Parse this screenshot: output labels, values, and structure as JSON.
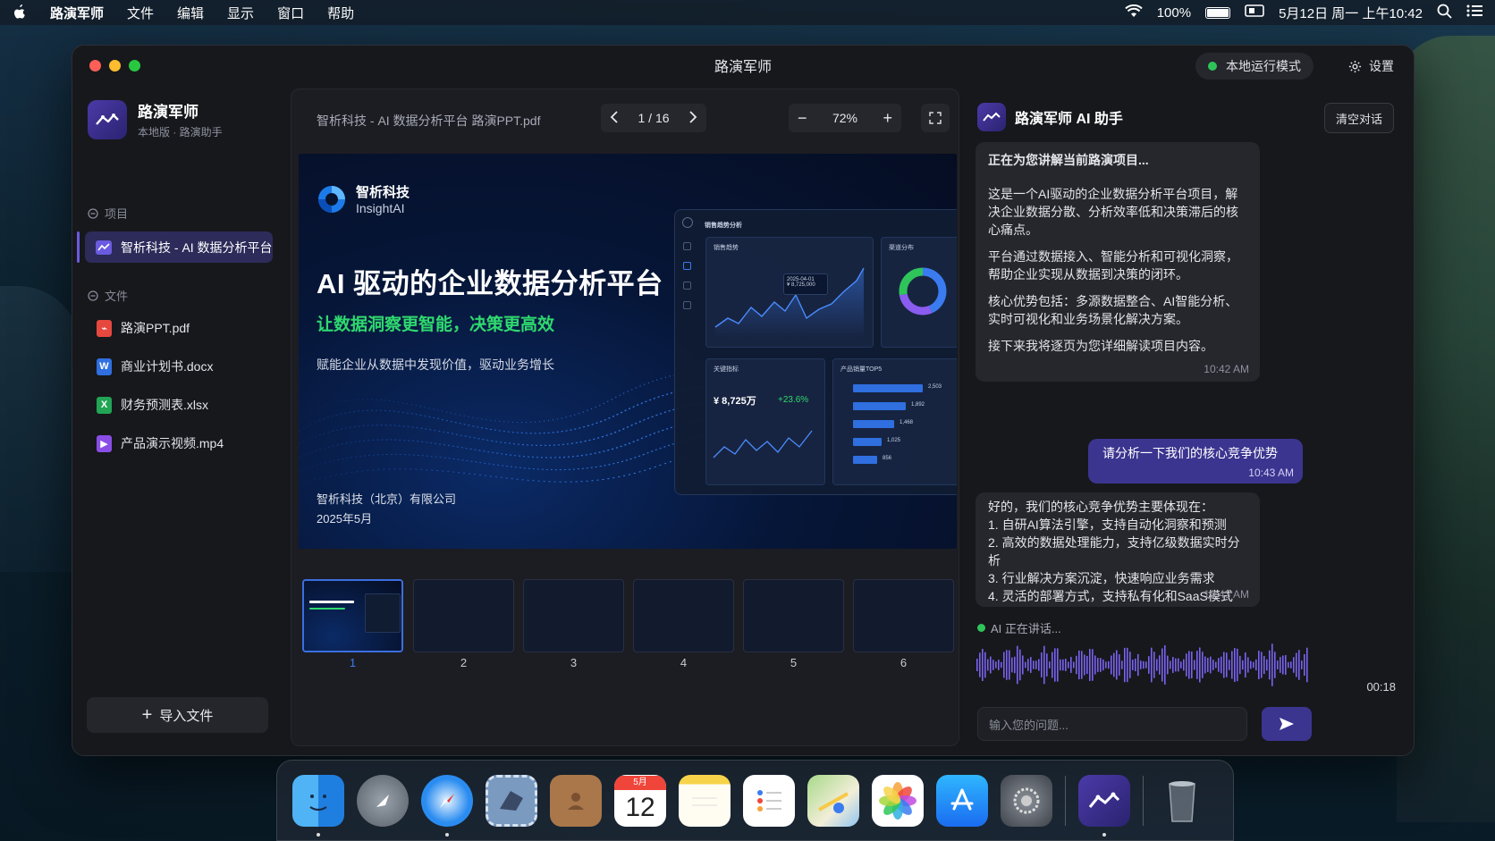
{
  "menubar": {
    "app": "路演军师",
    "menus": [
      "文件",
      "编辑",
      "显示",
      "窗口",
      "帮助"
    ],
    "battery": "100%",
    "datetime": "5月12日 周一 上午10:42",
    "battery_level": 1.0
  },
  "window": {
    "title": "路演军师",
    "mode": "本地运行模式",
    "settings": "设置"
  },
  "sidebar": {
    "app_name": "路演军师",
    "app_sub": "本地版 · 路演助手",
    "projects_label": "项目",
    "project": "智析科技 - AI 数据分析平台",
    "files_label": "文件",
    "files": [
      {
        "name": "路演PPT.pdf",
        "icon": "pdf-icon",
        "color": "#e5483e"
      },
      {
        "name": "商业计划书.docx",
        "icon": "word-icon",
        "color": "#2f6fe0"
      },
      {
        "name": "财务预测表.xlsx",
        "icon": "excel-icon",
        "color": "#22a455"
      },
      {
        "name": "产品演示视频.mp4",
        "icon": "video-icon",
        "color": "#8a4ee6"
      }
    ],
    "import": "导入文件"
  },
  "viewer": {
    "filename": "智析科技 - AI 数据分析平台 路演PPT.pdf",
    "page": "1 / 16",
    "zoom": "72%"
  },
  "slide": {
    "brand_cn": "智析科技",
    "brand_en": "InsightAI",
    "title": "AI 驱动的企业数据分析平台",
    "subtitle": "让数据洞察更智能，决策更高效",
    "desc": "赋能企业从数据中发现价值，驱动业务增长",
    "company": "智析科技（北京）有限公司",
    "date": "2025年5月",
    "dashboard": {
      "header": "销售趋势分析",
      "c1": "销售趋势",
      "c2": "渠道分布",
      "c3": "关键指标",
      "c4": "产品销量TOP5",
      "tooltip_date": "2025-04-01",
      "tooltip_val": "¥ 8,725,000",
      "kpi": "¥ 8,725万",
      "kpi_change": "+23.6%",
      "top5": [
        "2,503",
        "1,892",
        "1,468",
        "1,025",
        "856"
      ]
    }
  },
  "thumbnails": [
    "1",
    "2",
    "3",
    "4",
    "5",
    "6"
  ],
  "chat": {
    "title": "路演军师 AI 助手",
    "clear": "清空对话",
    "m1_head": "正在为您讲解当前路演项目...",
    "m1_p1": "这是一个AI驱动的企业数据分析平台项目，解决企业数据分散、分析效率低和决策滞后的核心痛点。",
    "m1_p2": "平台通过数据接入、智能分析和可视化洞察，帮助企业实现从数据到决策的闭环。",
    "m1_p3": "核心优势包括：多源数据整合、AI智能分析、实时可视化和业务场景化解决方案。",
    "m1_p4": "接下来我将逐页为您详细解读项目内容。",
    "m1_time": "10:42 AM",
    "user": "请分析一下我们的核心竞争优势",
    "user_time": "10:43 AM",
    "m2_head": "好的，我们的核心竞争优势主要体现在：",
    "m2_items": [
      "1. 自研AI算法引擎，支持自动化洞察和预测",
      "2. 高效的数据处理能力，支持亿级数据实时分析",
      "3. 行业解决方案沉淀，快速响应业务需求",
      "4. 灵活的部署方式，支持私有化和SaaS模式"
    ],
    "m2_time": "10:43 AM",
    "speaking": "AI 正在讲话...",
    "duration": "00:18",
    "placeholder": "输入您的问题..."
  },
  "dock": {
    "items": [
      "finder-icon",
      "launchpad-icon",
      "safari-icon",
      "mail-icon",
      "contacts-icon",
      "calendar-icon",
      "notes-icon",
      "reminders-icon",
      "maps-icon",
      "photos-icon",
      "app-store-icon",
      "system-settings-icon",
      "roadshow-app-icon",
      "trash-icon"
    ],
    "calendar_month": "5月",
    "calendar_day": "12"
  }
}
